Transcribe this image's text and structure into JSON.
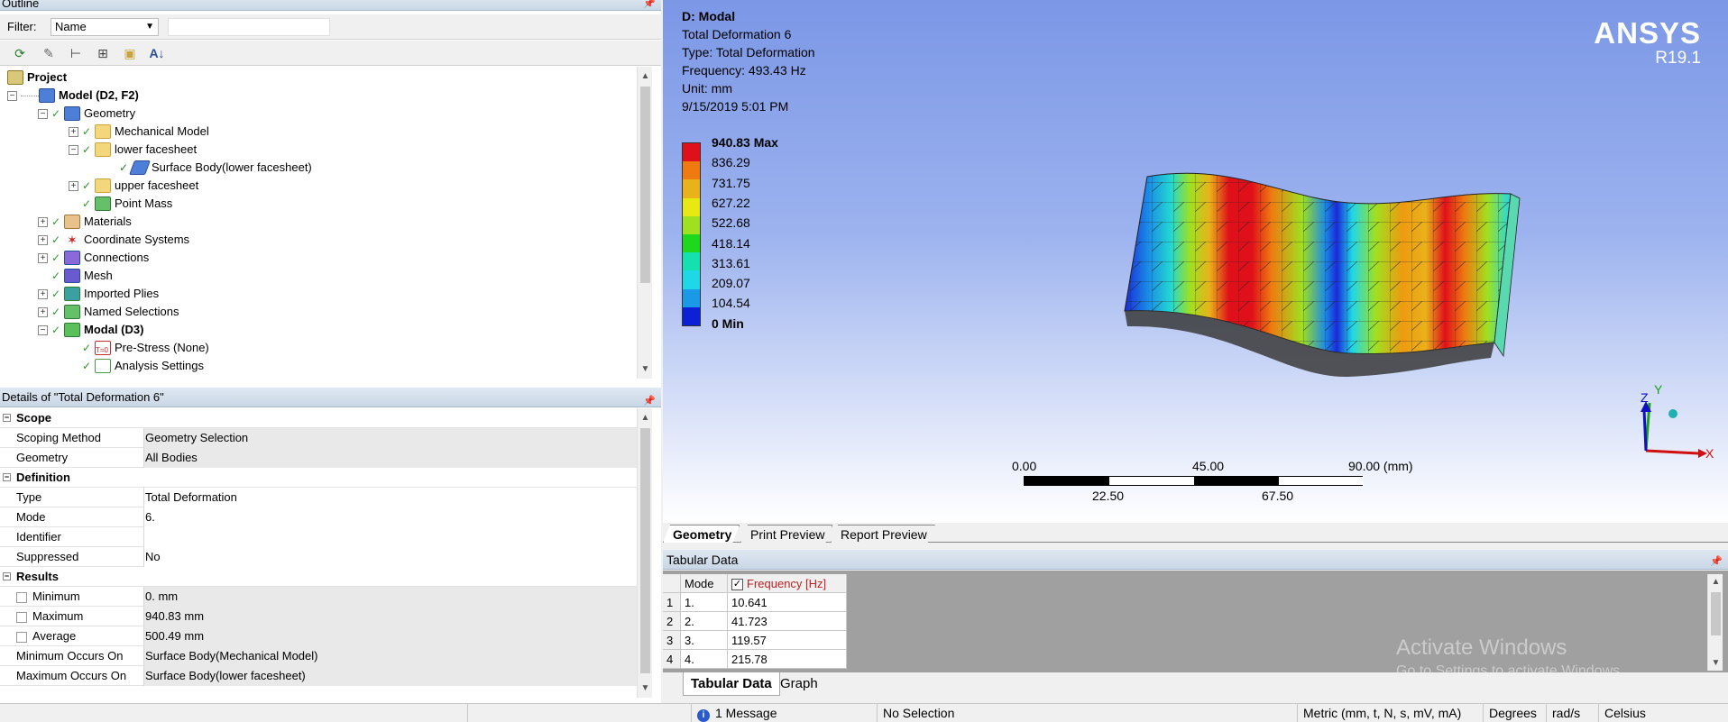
{
  "outline": {
    "title": "Outline",
    "filter_label": "Filter:",
    "filter_value": "Name",
    "tree": [
      {
        "label": "Project",
        "bold": true
      },
      {
        "label": "Model (D2, F2)",
        "bold": true
      },
      {
        "label": "Geometry"
      },
      {
        "label": "Mechanical Model"
      },
      {
        "label": "lower facesheet"
      },
      {
        "label": "Surface Body(lower facesheet)"
      },
      {
        "label": "upper facesheet"
      },
      {
        "label": "Point Mass"
      },
      {
        "label": "Materials"
      },
      {
        "label": "Coordinate Systems"
      },
      {
        "label": "Connections"
      },
      {
        "label": "Mesh"
      },
      {
        "label": "Imported Plies"
      },
      {
        "label": "Named Selections"
      },
      {
        "label": "Modal (D3)",
        "bold": true
      },
      {
        "label": "Pre-Stress (None)"
      },
      {
        "label": "Analysis Settings"
      }
    ]
  },
  "details": {
    "title": "Details of \"Total Deformation 6\"",
    "rows": [
      {
        "section": "Scope"
      },
      {
        "key": "Scoping Method",
        "value": "Geometry Selection"
      },
      {
        "key": "Geometry",
        "value": "All Bodies"
      },
      {
        "section": "Definition"
      },
      {
        "key": "Type",
        "value": "Total Deformation"
      },
      {
        "key": "Mode",
        "value": "6."
      },
      {
        "key": "Identifier",
        "value": ""
      },
      {
        "key": "Suppressed",
        "value": "No"
      },
      {
        "section": "Results"
      },
      {
        "key": "Minimum",
        "value": "0. mm",
        "checkbox": true
      },
      {
        "key": "Maximum",
        "value": "940.83 mm",
        "checkbox": true
      },
      {
        "key": "Average",
        "value": "500.49 mm",
        "checkbox": true
      },
      {
        "key": "Minimum Occurs On",
        "value": "Surface Body(Mechanical Model)"
      },
      {
        "key": "Maximum Occurs On",
        "value": "Surface Body(lower facesheet)"
      }
    ]
  },
  "viewport": {
    "title": "D: Modal",
    "lines": [
      "Total Deformation 6",
      "Type: Total Deformation",
      "Frequency: 493.43 Hz",
      "Unit: mm",
      "9/15/2019 5:01 PM"
    ],
    "legend": [
      "940.83 Max",
      "836.29",
      "731.75",
      "627.22",
      "522.68",
      "418.14",
      "313.61",
      "209.07",
      "104.54",
      "0 Min"
    ],
    "legend_colors": [
      "#e0101a",
      "#ee7a10",
      "#e9b21a",
      "#e8e812",
      "#9fe020",
      "#1ed81e",
      "#15e0b0",
      "#1ed8e8",
      "#1a9ae6",
      "#0c20d8"
    ],
    "logo": "ANSYS",
    "version": "R19.1",
    "scale_top": [
      "0.00",
      "45.00",
      "90.00 (mm)"
    ],
    "scale_bottom": [
      "22.50",
      "67.50"
    ],
    "triad": {
      "x": "X",
      "y": "Y",
      "z": "Z"
    }
  },
  "view_tabs": [
    "Geometry",
    "Print Preview",
    "Report Preview"
  ],
  "tabular": {
    "title": "Tabular Data",
    "headers": [
      "Mode",
      "Frequency [Hz]"
    ],
    "rows": [
      {
        "n": "1",
        "mode": "1.",
        "freq": "10.641"
      },
      {
        "n": "2",
        "mode": "2.",
        "freq": "41.723"
      },
      {
        "n": "3",
        "mode": "3.",
        "freq": "119.57"
      },
      {
        "n": "4",
        "mode": "4.",
        "freq": "215.78"
      }
    ]
  },
  "bottom_tabs": [
    "Tabular Data",
    "Graph"
  ],
  "watermark": {
    "line1": "Activate Windows",
    "line2": "Go to Settings to activate Windows."
  },
  "status": {
    "messages": "1 Message",
    "selection": "No Selection",
    "units": "Metric (mm, t, N, s, mV, mA)",
    "angle": "Degrees",
    "rate": "rad/s",
    "temp": "Celsius"
  }
}
